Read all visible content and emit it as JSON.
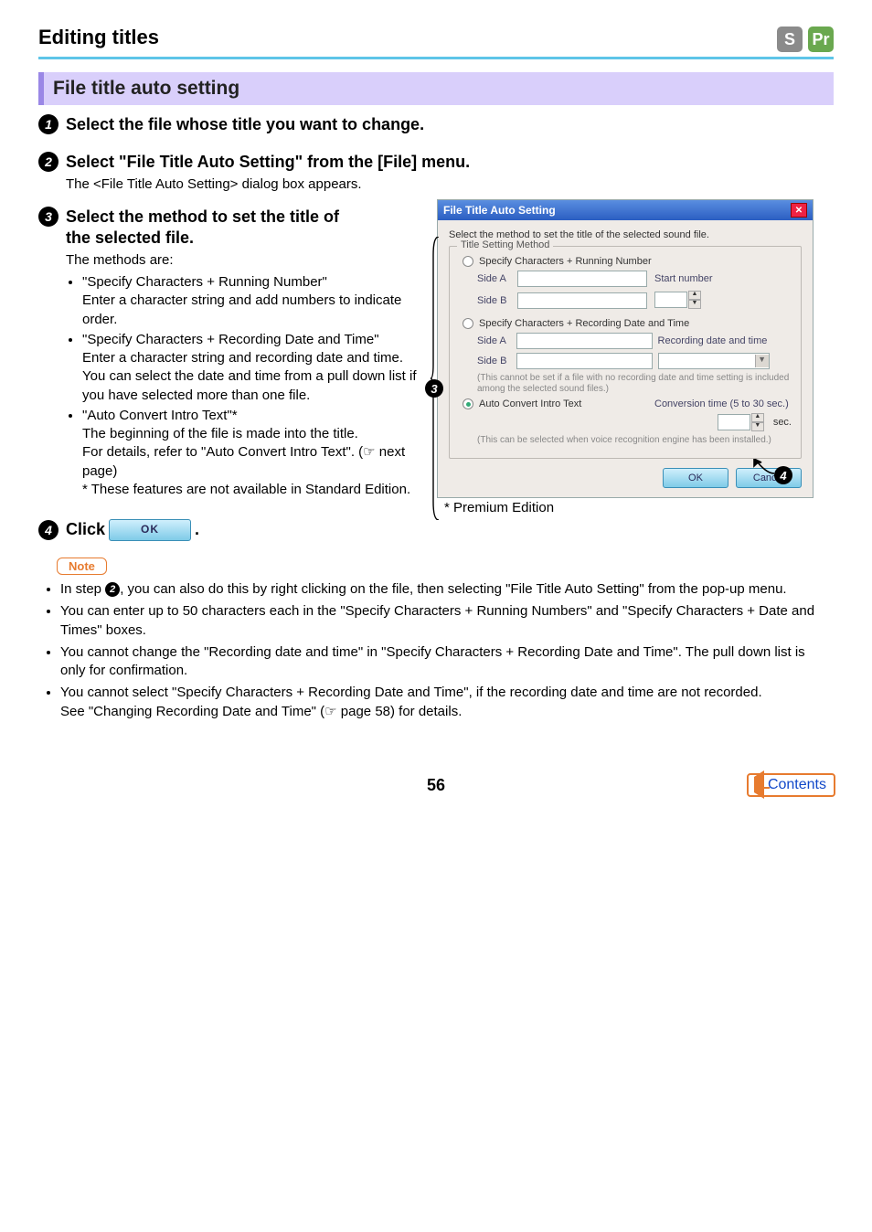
{
  "header": {
    "title": "Editing titles",
    "badge_s": "S",
    "badge_pr": "Pr"
  },
  "section_bar": "File title auto setting",
  "step1": {
    "num": "1",
    "head": "Select the file whose title you want to change."
  },
  "step2": {
    "num": "2",
    "head": "Select \"File Title Auto Setting\" from the [File] menu.",
    "body": "The <File Title Auto Setting> dialog box appears."
  },
  "step3": {
    "num": "3",
    "head_line1": "Select the method to set the title of",
    "head_line2": "the selected file.",
    "intro": "The methods are:",
    "b1_title": "\"Specify Characters + Running Number\"",
    "b1_body": "Enter a character string and add numbers to indicate order.",
    "b2_title": "\"Specify Characters + Recording Date and Time\"",
    "b2_body1": "Enter a character string and recording date and time.",
    "b2_body2": "You can select the date and time from a pull down list if you have selected more than one file.",
    "b3_title": "\"Auto Convert Intro Text\"*",
    "b3_body1": "The beginning of the file is made into the title.",
    "b3_body2a": "For details, refer to \"Auto Convert Intro Text\". (",
    "b3_body2b": " next page)",
    "b3_note": "* These features are not available in Standard Edition."
  },
  "step4": {
    "num": "4",
    "pre": "Click ",
    "btn": "OK",
    "post": "."
  },
  "dialog": {
    "title": "File Title Auto Setting",
    "desc": "Select the method to set the title of the selected sound file.",
    "group": "Title Setting Method",
    "r1": "Specify Characters + Running Number",
    "sideA": "Side A",
    "sideB": "Side B",
    "startnum": "Start number",
    "r2": "Specify Characters + Recording Date and Time",
    "recdt": "Recording date and time",
    "warn1": "(This cannot be set if a file with no recording date and time setting is included among the selected sound files.)",
    "r3": "Auto Convert Intro Text",
    "conv": "Conversion time (5 to 30 sec.)",
    "sec": "sec.",
    "warn2": "(This can be selected when voice recognition engine has been installed.)",
    "ok": "OK",
    "cancel": "Cancel",
    "marker3": "3",
    "marker4": "4"
  },
  "premium_caption": "* Premium Edition",
  "note": {
    "label": "Note",
    "n1a": "In step ",
    "n1num": "2",
    "n1b": ", you can also do this by right clicking on the file, then selecting \"File Title Auto Setting\" from the pop-up menu.",
    "n2": "You can enter up to 50 characters each in the \"Specify Characters + Running Numbers\" and \"Specify Characters + Date and Times\" boxes.",
    "n3": "You cannot change the \"Recording date and time\" in \"Specify Characters + Recording Date and Time\". The pull down list is only for confirmation.",
    "n4a": "You cannot select \"Specify Characters + Recording Date and Time\", if the recording date and time are not recorded.",
    "n4b_pre": "See \"Changing Recording Date and Time\" (",
    "n4b_post": " page 58) for details."
  },
  "pointer_glyph": "☞",
  "page_num": "56",
  "contents_label": "Contents"
}
